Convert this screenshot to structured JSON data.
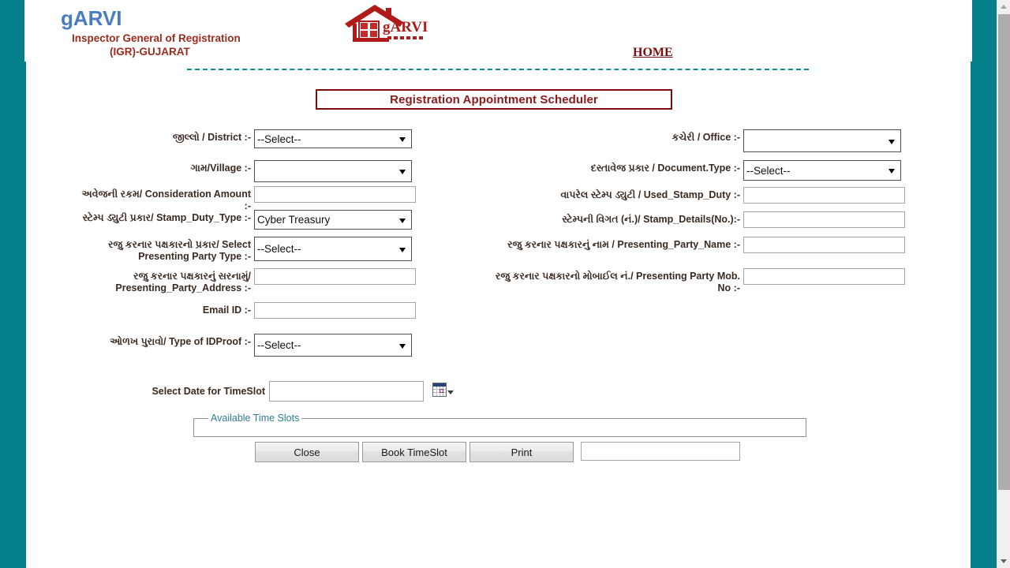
{
  "brand": {
    "name": "gARVI",
    "sub_line1": "Inspector General of Registration",
    "sub_line2": "(IGR)-GUJARAT",
    "logo_text": "gARVI",
    "logo_icon": "house-logo-icon",
    "accent_blue": "#4a7cc0",
    "accent_maroon": "#9d2b1e",
    "teal": "#04808a"
  },
  "nav": {
    "home_label": "HOME"
  },
  "page": {
    "title": "Registration Appointment Scheduler",
    "title_color": "#8b1a1a"
  },
  "form": {
    "left": [
      {
        "label_gu": "જીલ્લો",
        "label_en": "District",
        "label": "જીલ્લો / District :-",
        "type": "select",
        "value": "--Select--"
      },
      {
        "label_gu": "ગામ",
        "label_en": "Village",
        "label": "ગામ/Village :-",
        "type": "select",
        "value": ""
      },
      {
        "label_gu": "અવેજની રકમ",
        "label_en": "Consideration Amount",
        "label": "અવેજની રકમ/ Consideration Amount :-",
        "type": "text",
        "value": ""
      },
      {
        "label_gu": "સ્ટેમ્પ ડ્યુટી પ્રકાર",
        "label_en": "Stamp_Duty_Type",
        "label": "સ્ટેમ્પ ડ્યુટી પ્રકાર/ Stamp_Duty_Type :-",
        "type": "select",
        "value": "Cyber Treasury"
      },
      {
        "label_gu": "રજુ કરનાર પક્ષકારનો પ્રકાર",
        "label_en": "Select Presenting Party Type",
        "label": "રજુ કરનાર પક્ષકારનો પ્રકાર/ Select Presenting Party Type :-",
        "type": "select",
        "value": "--Select--"
      },
      {
        "label_gu": "રજુ કરનાર પક્ષકારનું સરનામું",
        "label_en": "Presenting_Party_Address",
        "label": "રજુ કરનાર પક્ષકારનું સરનામું/ Presenting_Party_Address :-",
        "type": "text",
        "value": ""
      },
      {
        "label_gu": "",
        "label_en": "Email ID",
        "label": "Email ID :-",
        "type": "text",
        "value": ""
      },
      {
        "label_gu": "ઓળખ પુરાવો",
        "label_en": "Type of IDProof",
        "label": "ઓળખ પુરાવો/ Type of IDProof :-",
        "type": "select",
        "value": "--Select--"
      }
    ],
    "right": [
      {
        "label_gu": "કચેરી",
        "label_en": "Office",
        "label": "કચેરી / Office :-",
        "type": "select",
        "value": ""
      },
      {
        "label_gu": "દસ્તાવેજ પ્રકાર",
        "label_en": "Document.Type",
        "label": "દસ્તાવેજ પ્રકાર / Document.Type :-",
        "type": "select",
        "value": "--Select--"
      },
      {
        "label_gu": "વાપરેલ સ્ટેમ્પ ડ્યુટી",
        "label_en": "Used_Stamp_Duty",
        "label": "વાપરેલ સ્ટેમ્પ ડ્યુટી / Used_Stamp_Duty :-",
        "type": "text",
        "value": ""
      },
      {
        "label_gu": "સ્ટેમ્પની વિગત (નં.)",
        "label_en": "Stamp_Details(No.)",
        "label": "સ્ટેમ્પની વિગત (નં.)/ Stamp_Details(No.):-",
        "type": "text",
        "value": ""
      },
      {
        "label_gu": "રજુ કરનાર પક્ષકારનું નામ",
        "label_en": "Presenting_Party_Name",
        "label": "રજુ કરનાર પક્ષકારનું નામ / Presenting_Party_Name :-",
        "type": "text",
        "value": ""
      },
      {
        "label_gu": "રજુ કરનાર પક્ષકારનો મોબાઈલ નં.",
        "label_en": "Presenting Party Mob. No",
        "label": "રજુ કરનાર પક્ષકારનો મોબાઈલ નં./ Presenting Party Mob. No :-",
        "type": "text",
        "value": ""
      }
    ]
  },
  "date_section": {
    "label": "Select Date for TimeSlot",
    "value": "",
    "calendar_icon": "calendar-icon"
  },
  "timeslots": {
    "legend": "Available Time Slots",
    "legend_color": "#2f7f91",
    "items": []
  },
  "buttons": {
    "close": "Close",
    "book": "Book TimeSlot",
    "print": "Print",
    "extra_field_value": ""
  }
}
